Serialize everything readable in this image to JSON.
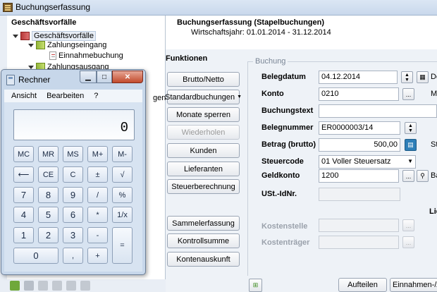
{
  "window": {
    "title": "Buchungserfassung"
  },
  "tree": {
    "title": "Geschäftsvorfälle",
    "root": "Geschäftsvorfälle",
    "items": [
      {
        "label": "Zahlungseingang"
      },
      {
        "label": "Einnahmebuchung"
      },
      {
        "label": "Zahlungsausgang"
      }
    ],
    "cut_text": "gen"
  },
  "header": {
    "title": "Buchungserfassung (Stapelbuchungen)",
    "subtitle": "Wirtschaftsjahr: 01.01.2014 - 31.12.2014"
  },
  "funktionen": {
    "title": "Funktionen",
    "buttons": [
      {
        "label": "Brutto/Netto"
      },
      {
        "label": "Standardbuchungen"
      },
      {
        "label": "Monate sperren"
      },
      {
        "label": "Wiederholen"
      },
      {
        "label": "Kunden"
      },
      {
        "label": "Lieferanten"
      },
      {
        "label": "Steuerberechnung"
      },
      {
        "label": "Sammelerfassung"
      },
      {
        "label": "Kontrollsumme"
      },
      {
        "label": "Kontenauskunft"
      }
    ]
  },
  "buchung": {
    "group_label": "Buchung",
    "belegdatum": {
      "label": "Belegdatum",
      "value": "04.12.2014"
    },
    "konto": {
      "label": "Konto",
      "value": "0210",
      "btn": "..."
    },
    "buchungstext": {
      "label": "Buchungstext",
      "value": ""
    },
    "belegnummer": {
      "label": "Belegnummer",
      "value": "ER0000003/14"
    },
    "betrag": {
      "label": "Betrag (brutto)",
      "value": "500,00"
    },
    "steuercode": {
      "label": "Steuercode",
      "value": "01 Voller Steuersatz"
    },
    "geldkonto": {
      "label": "Geldkonto",
      "value": "1200",
      "btn": "..."
    },
    "ustid": {
      "label": "USt.-IdNr.",
      "value": ""
    },
    "kostenstelle": {
      "label": "Kostenstelle",
      "btn": "..."
    },
    "kostentraeger": {
      "label": "Kostenträger",
      "btn": "..."
    },
    "right_cut": [
      "Do",
      "Ma",
      "St",
      "Ba",
      "Lie"
    ]
  },
  "bottom": {
    "aufteilen": "Aufteilen",
    "einnahmen": "Einnahmen-/Au"
  },
  "calculator": {
    "title": "Rechner",
    "menu": [
      "Ansicht",
      "Bearbeiten",
      "?"
    ],
    "display": "0",
    "keys": [
      "MC",
      "MR",
      "MS",
      "M+",
      "M-",
      "⟵",
      "CE",
      "C",
      "±",
      "√",
      "7",
      "8",
      "9",
      "/",
      "%",
      "4",
      "5",
      "6",
      "*",
      "1/x",
      "1",
      "2",
      "3",
      "-",
      "=",
      "0",
      ",",
      "+"
    ]
  }
}
